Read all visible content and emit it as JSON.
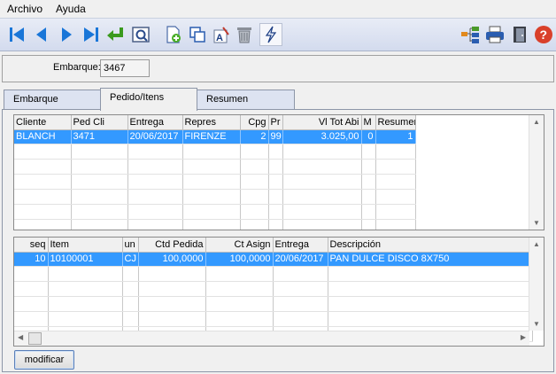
{
  "menu": {
    "items": [
      "Archivo",
      "Ayuda"
    ]
  },
  "toolbar": {
    "icons": [
      "first-record-icon",
      "previous-record-icon",
      "next-record-icon",
      "last-record-icon",
      "enter-icon",
      "preview-icon",
      "new-document-icon",
      "copy-icon",
      "text-format-icon",
      "trash-icon",
      "lightning-icon",
      "network-icon",
      "print-icon",
      "exit-door-icon",
      "help-icon"
    ],
    "accent": "#1976d8"
  },
  "embarque": {
    "label": "Embarque:",
    "value": "3467"
  },
  "tabs": [
    {
      "label": "Embarque"
    },
    {
      "label": "Pedido/Itens",
      "active": true
    },
    {
      "label": "Resumen"
    }
  ],
  "orders": {
    "columns": [
      "Cliente",
      "Ped Cli",
      "Entrega",
      "Repres",
      "Cpg",
      "Pr",
      "Vl Tot Abi",
      "M",
      "Resumen"
    ],
    "rows": [
      [
        "BLANCH",
        "3471",
        "20/06/2017",
        "FIRENZE",
        "2",
        "99",
        "3.025,00",
        "0",
        "1"
      ]
    ],
    "selected_color": "#3399ff"
  },
  "items": {
    "columns": [
      "seq",
      "Item",
      "un",
      "Ctd Pedida",
      "Ct Asign",
      "Entrega",
      "Descripción"
    ],
    "rows": [
      [
        "10",
        "10100001",
        "CJ",
        "100,0000",
        "100,0000",
        "20/06/2017",
        "PAN DULCE DISCO 8X750"
      ]
    ]
  },
  "buttons": {
    "modify_label": "modificar"
  }
}
